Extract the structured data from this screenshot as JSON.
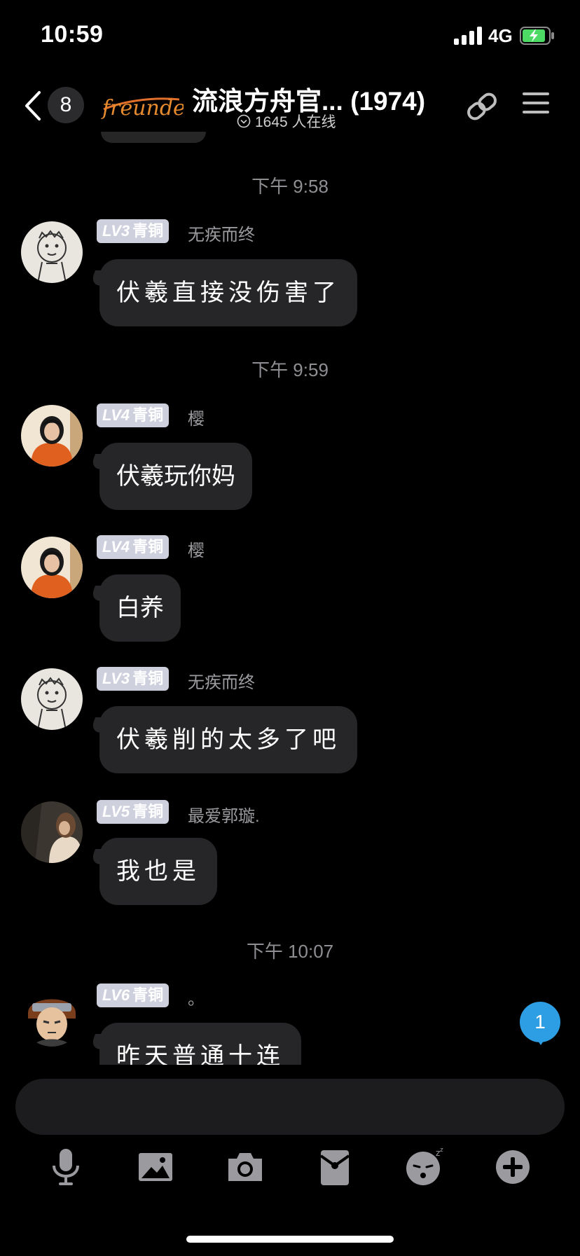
{
  "status_bar": {
    "time": "10:59",
    "network": "4G"
  },
  "header": {
    "unread_count": "8",
    "logo_text": "freunde",
    "title": "流浪方舟官... (1974)",
    "online": "1645 人在线"
  },
  "timestamps": [
    "下午 9:58",
    "下午 9:59",
    "下午 10:07"
  ],
  "messages": [
    {
      "level": "LV3",
      "rank": "青铜",
      "user": "无疾而终",
      "text": "伏羲直接没伤害了"
    },
    {
      "level": "LV4",
      "rank": "青铜",
      "user": "樱",
      "text": "伏羲玩你妈"
    },
    {
      "level": "LV4",
      "rank": "青铜",
      "user": "樱",
      "text": "白养"
    },
    {
      "level": "LV3",
      "rank": "青铜",
      "user": "无疾而终",
      "text": "伏羲削的太多了吧"
    },
    {
      "level": "LV5",
      "rank": "青铜",
      "user": "最爱郭璇.",
      "text": "我也是"
    },
    {
      "level": "LV6",
      "rank": "青铜",
      "user": "。",
      "text": "昨天普通十连"
    }
  ],
  "unread_badge": "1",
  "toolbar": [
    "microphone-icon",
    "image-icon",
    "camera-icon",
    "red-packet-icon",
    "sticker-icon",
    "plus-icon"
  ],
  "colors": {
    "bubble": "#262628",
    "level_badge": "#cfd0de",
    "unread": "#2d9ee3"
  }
}
